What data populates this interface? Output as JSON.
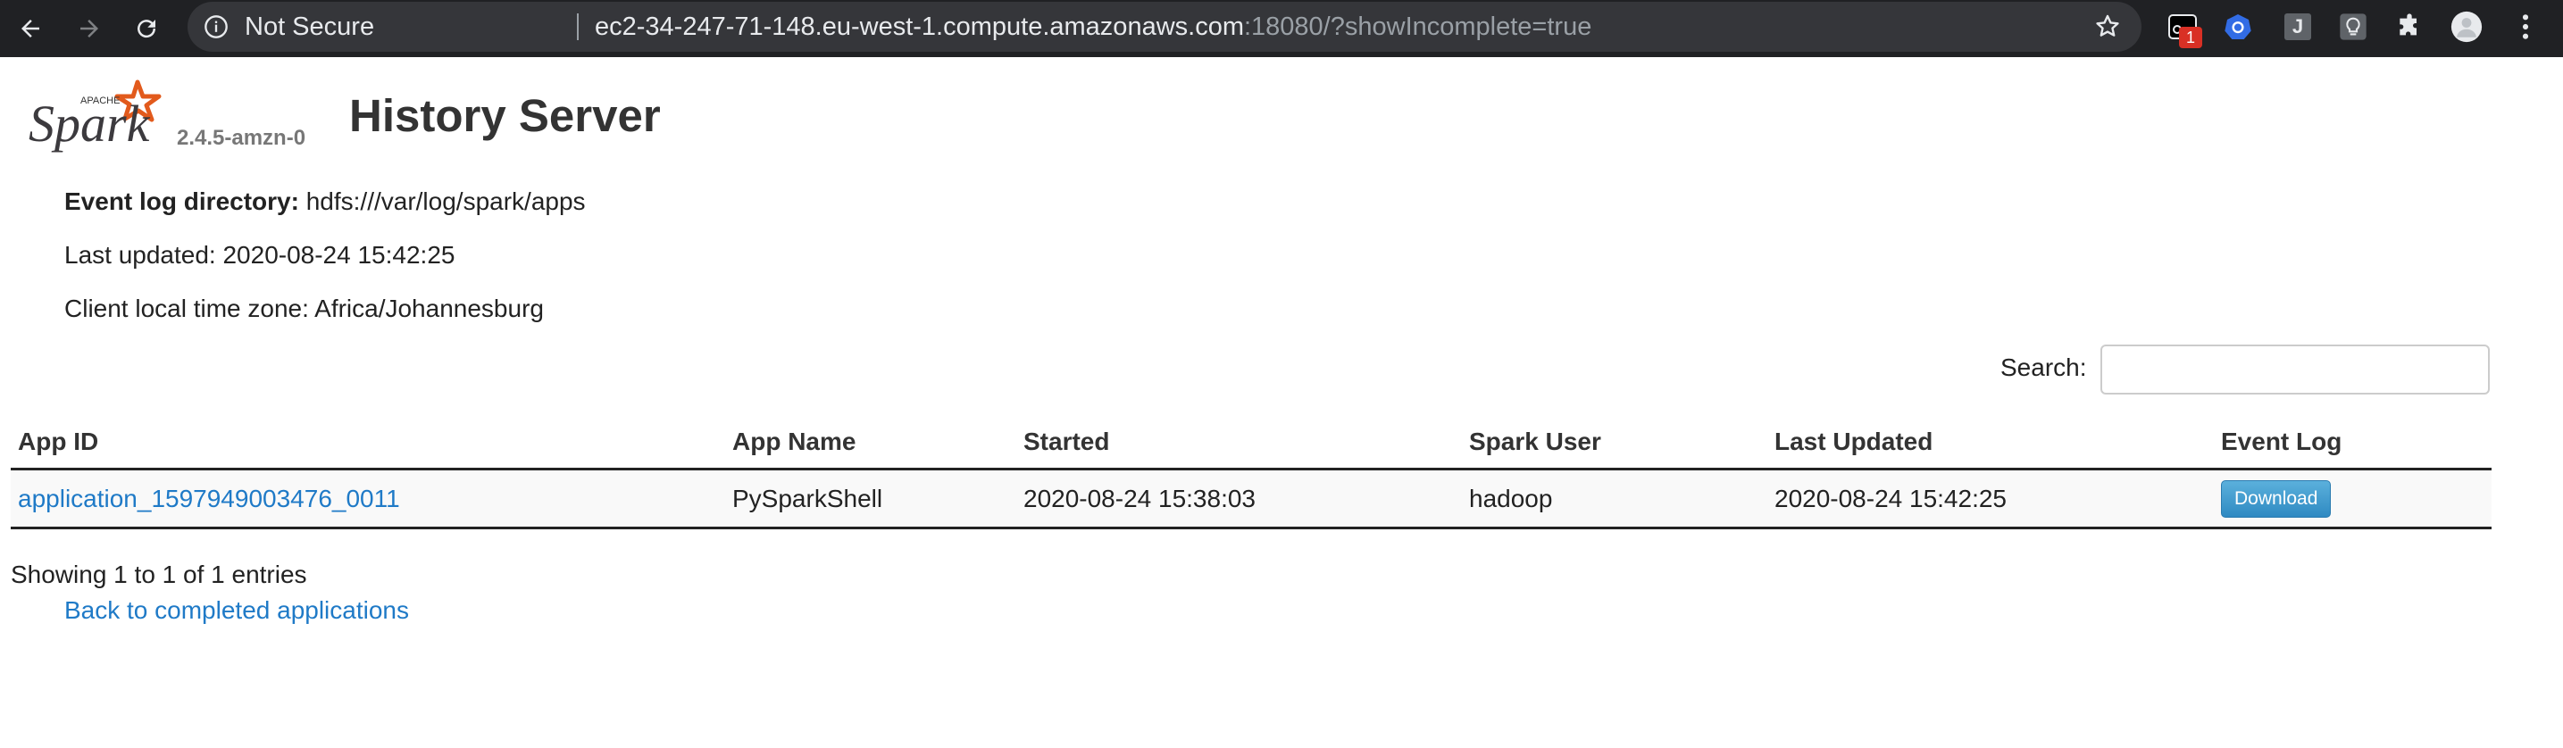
{
  "browser": {
    "security_label": "Not Secure",
    "url_host": "ec2-34-247-71-148.eu-west-1.compute.amazonaws.com",
    "url_rest": ":18080/?showIncomplete=true",
    "extension_badge": "1",
    "extension_letter": "J"
  },
  "header": {
    "logo_apache": "APACHE",
    "logo_text": "Spark",
    "version": "2.4.5-amzn-0",
    "title": "History Server"
  },
  "info": {
    "event_log_label": "Event log directory:",
    "event_log_value": "hdfs:///var/log/spark/apps",
    "last_updated": "Last updated: 2020-08-24 15:42:25",
    "timezone": "Client local time zone: Africa/Johannesburg"
  },
  "search": {
    "label": "Search:",
    "value": "",
    "placeholder": ""
  },
  "table": {
    "columns": [
      "App ID",
      "App Name",
      "Started",
      "Spark User",
      "Last Updated",
      "Event Log"
    ],
    "rows": [
      {
        "app_id": "application_1597949003476_0011",
        "app_name": "PySparkShell",
        "started": "2020-08-24 15:38:03",
        "spark_user": "hadoop",
        "last_updated": "2020-08-24 15:42:25",
        "event_log_button": "Download"
      }
    ]
  },
  "footer": {
    "entries": "Showing 1 to 1 of 1 entries",
    "back_link": "Back to completed applications"
  },
  "colors": {
    "chrome_bg": "#202124",
    "omnibox_bg": "#35363a",
    "link": "#1f7ac7",
    "logo_orange": "#e25a1c",
    "button_blue": "#3a95cf"
  }
}
